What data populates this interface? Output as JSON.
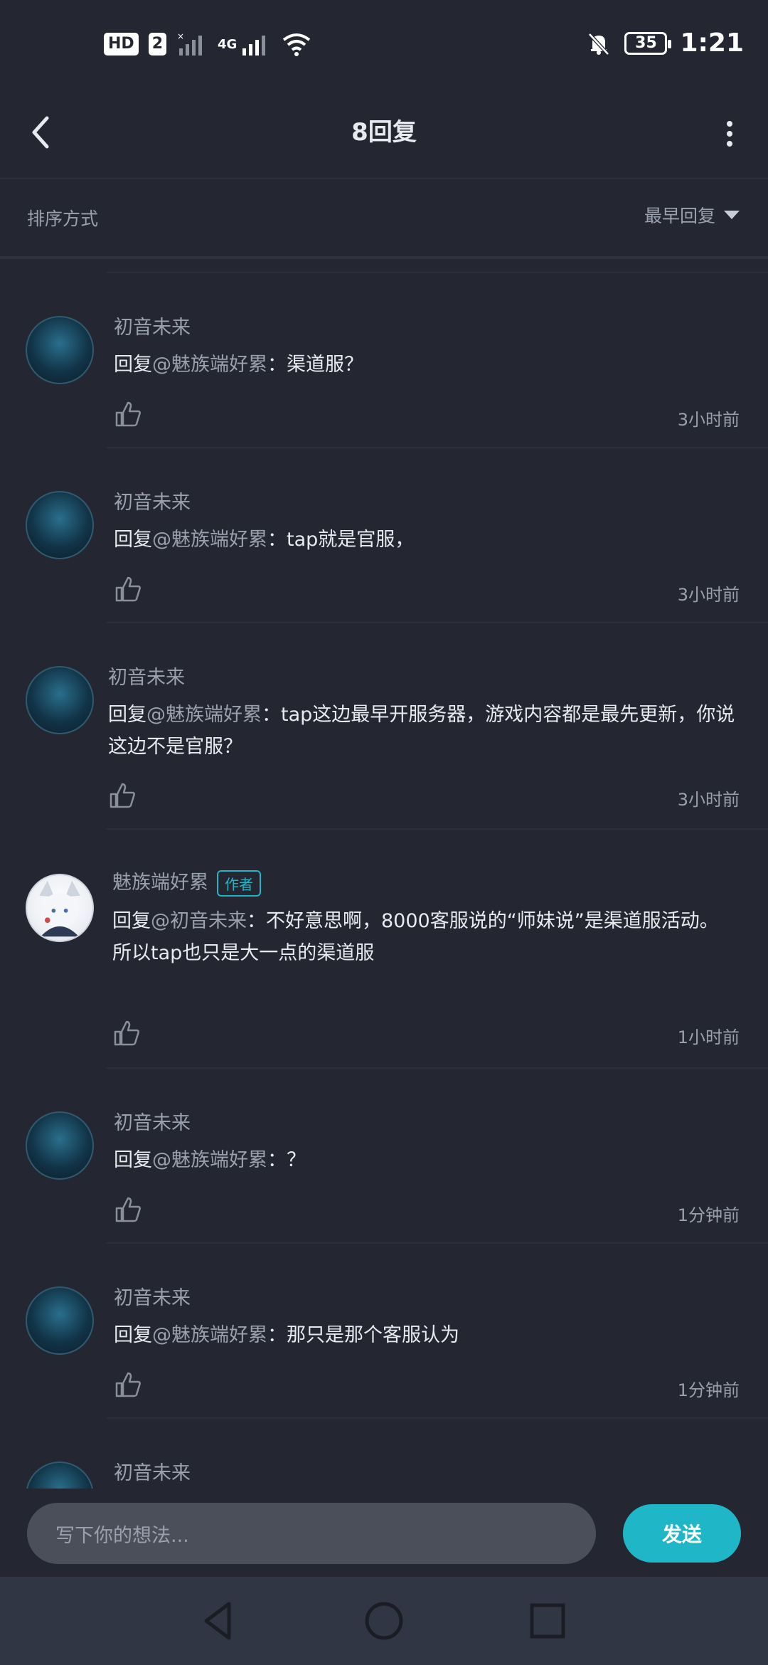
{
  "status_bar": {
    "hd_label": "HD",
    "sim_label": "2",
    "net_label": "4G",
    "battery": "35",
    "time": "1:21",
    "icons": [
      "signal-icon",
      "4g-signal-icon",
      "wifi-icon",
      "mute-icon",
      "battery-icon"
    ]
  },
  "header": {
    "title": "8回复"
  },
  "sort": {
    "label": "排序方式",
    "value": "最早回复"
  },
  "comments": [
    {
      "name": "初音未来",
      "reply_prefix": "回复",
      "mention": "@魅族端好累",
      "text": "：渠道服？",
      "time": "3小时前",
      "avatar": "miku"
    },
    {
      "name": "初音未来",
      "reply_prefix": "回复",
      "mention": "@魅族端好累",
      "text": "：tap就是官服，",
      "time": "3小时前",
      "avatar": "miku"
    },
    {
      "name": "初音未来",
      "reply_prefix": "回复",
      "mention": "@魅族端好累",
      "text": "：tap这边最早开服务器，游戏内容都是最先更新，你说这边不是官服？",
      "time": "3小时前",
      "avatar": "miku"
    },
    {
      "name": "魅族端好累",
      "author_tag": "作者",
      "reply_prefix": "回复",
      "mention": "@初音未来",
      "text": "：不好意思啊，8000客服说的“师妹说”是渠道服活动。",
      "text2": "所以tap也只是大一点的渠道服",
      "time": "1小时前",
      "avatar": "fox"
    },
    {
      "name": "初音未来",
      "reply_prefix": "回复",
      "mention": "@魅族端好累",
      "text": "：？",
      "time": "1分钟前",
      "avatar": "miku"
    },
    {
      "name": "初音未来",
      "reply_prefix": "回复",
      "mention": "@魅族端好累",
      "text": "：那只是那个客服认为",
      "time": "1分钟前",
      "avatar": "miku"
    },
    {
      "name": "初音未来",
      "avatar": "miku"
    }
  ],
  "input": {
    "placeholder": "写下你的想法...",
    "send_label": "发送"
  },
  "colors": {
    "background": "#242732",
    "accent": "#1fb7c7",
    "muted_text": "#9aa0ad",
    "input_bg": "#4b4f59",
    "navbar_bg": "#313644"
  }
}
